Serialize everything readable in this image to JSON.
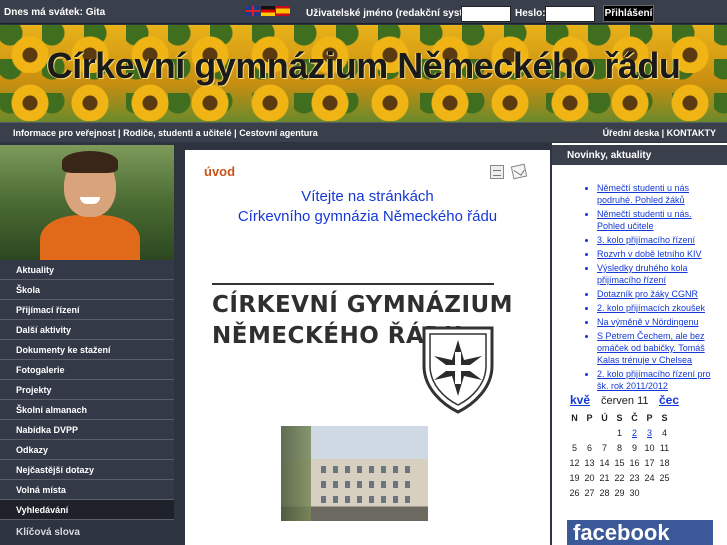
{
  "topbar": {
    "nameday": "Dnes má svátek: Gita",
    "username_label": "Uživatelské jméno (redakční systém):",
    "password_label": "Heslo:",
    "login_button": "Přihlášení",
    "flags": [
      "flag-uk-icon",
      "flag-de-icon",
      "flag-es-icon"
    ]
  },
  "banner": {
    "title": "Církevní gymnázium Německého řádu"
  },
  "navbar": {
    "left": [
      "Informace pro veřejnost",
      "Rodiče, studenti a učitelé",
      "Cestovní agentura"
    ],
    "separator": "|",
    "right": [
      "Úřední deska",
      "KONTAKTY"
    ]
  },
  "sidebar": {
    "items": [
      "Aktuality",
      "Škola",
      "Přijímací řízení",
      "Další aktivity",
      "Dokumenty ke stažení",
      "Fotogalerie",
      "Projekty",
      "Školní almanach",
      "Nabídka DVPP",
      "Odkazy",
      "Nejčastější dotazy",
      "Volná místa",
      "Vyhledávání"
    ],
    "keywords_label": "Klíčová slova"
  },
  "main": {
    "section_title": "úvod",
    "welcome_line1": "Vítejte na stránkách",
    "welcome_line2": "Církevního gymnázia Německého řádu",
    "logo_line1": "CÍRKEVNÍ GYMNÁZIUM",
    "logo_line2": "NĚMECKÉHO ŘÁDU"
  },
  "right": {
    "heading": "Novinky, aktuality",
    "news": [
      "Němečtí studenti u nás podruhé. Pohled žáků",
      "Němečtí studenti u nás. Pohled učitele",
      "3. kolo přijímacího řízení",
      "Rozvrh v době letního KIV",
      "Výsledky druhého kola přijímacího řízení",
      "Dotazník pro žáky CGNR",
      "2. kolo přijímacích zkoušek",
      "Na výměně v Nördingenu",
      "S Petrem Čechem, ale bez omáček od babičky. Tomáš Kalas trénuje v Chelsea",
      "2. kolo přijímacího řízení pro šk. rok 2011/2012"
    ],
    "calendar": {
      "prev": "kvě",
      "month": "červen 11",
      "next": "čec",
      "day_headers": [
        "N",
        "P",
        "Ú",
        "S",
        "Č",
        "P",
        "S"
      ],
      "cells": [
        "",
        "",
        "",
        "1",
        "2",
        "3",
        "4",
        "5",
        "6",
        "7",
        "8",
        "9",
        "10",
        "11",
        "12",
        "13",
        "14",
        "15",
        "16",
        "17",
        "18",
        "19",
        "20",
        "21",
        "22",
        "23",
        "24",
        "25",
        "26",
        "27",
        "28",
        "29",
        "30",
        "",
        ""
      ],
      "linked_days": [
        "2",
        "3"
      ]
    },
    "facebook_label": "facebook"
  }
}
